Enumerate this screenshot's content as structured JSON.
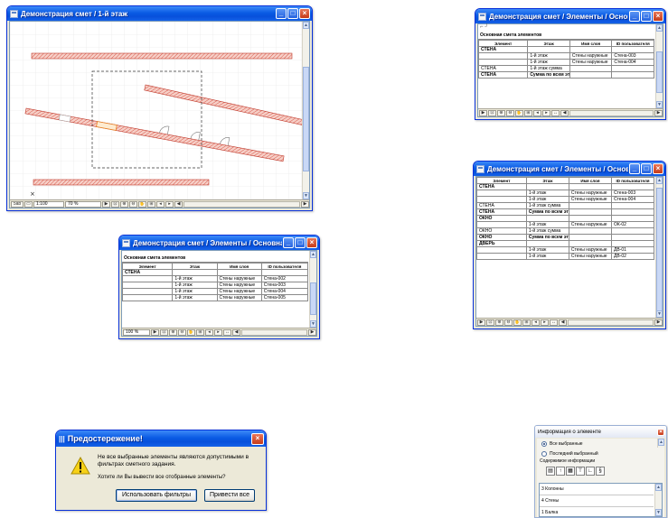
{
  "plan_window": {
    "title": "Демонстрация смет / 1-й этаж",
    "scale": "1:100",
    "zoom": "70 %",
    "toggle_icon": "5ab"
  },
  "table_window_top": {
    "title": "Демонстрация смет / Элементы / Основная...",
    "caption": "Основная смета элементов",
    "headers": [
      "Элемент",
      "Этаж",
      "Имя слоя",
      "ID пользователя"
    ],
    "rows": [
      {
        "cells": [
          "СТЕНА",
          "",
          "",
          ""
        ],
        "bold": true
      },
      {
        "cells": [
          "",
          "1-й этаж",
          "Стены наружные",
          "Стена-003"
        ],
        "bold": false
      },
      {
        "cells": [
          "",
          "1-й этаж",
          "Стены наружные",
          "Стена-004"
        ],
        "bold": false
      },
      {
        "cells": [
          "СТЕНА",
          "1-й этаж сумма",
          "",
          ""
        ],
        "bold": false
      },
      {
        "cells": [
          "СТЕНА",
          "Сумма по всем этажам",
          "",
          ""
        ],
        "bold": true
      }
    ]
  },
  "table_window_mid": {
    "title": "Демонстрация смет / Элементы / Основная см...",
    "caption": "Основная смета элементов",
    "zoom": "100 %",
    "headers": [
      "Элемент",
      "Этаж",
      "Имя слоя",
      "ID пользователя"
    ],
    "rows": [
      {
        "cells": [
          "СТЕНА",
          "",
          "",
          ""
        ],
        "bold": true
      },
      {
        "cells": [
          "",
          "1-й этаж",
          "Стены наружные",
          "Стена-002"
        ],
        "bold": false
      },
      {
        "cells": [
          "",
          "1-й этаж",
          "Стены наружные",
          "Стена-003"
        ],
        "bold": false
      },
      {
        "cells": [
          "",
          "1-й этаж",
          "Стены наружные",
          "Стена-004"
        ],
        "bold": false
      },
      {
        "cells": [
          "",
          "1-й этаж",
          "Стены наружные",
          "Стена-005"
        ],
        "bold": false
      }
    ]
  },
  "table_window_right": {
    "title": "Демонстрация смет / Элементы / Основная ...",
    "headers": [
      "Элемент",
      "Этаж",
      "Имя слоя",
      "ID пользователя"
    ],
    "rows": [
      {
        "cells": [
          "СТЕНА",
          "",
          "",
          ""
        ],
        "bold": true
      },
      {
        "cells": [
          "",
          "1-й этаж",
          "Стены наружные",
          "Стена-003"
        ],
        "bold": false
      },
      {
        "cells": [
          "",
          "1-й этаж",
          "Стены наружные",
          "Стена-004"
        ],
        "bold": false
      },
      {
        "cells": [
          "СТЕНА",
          "1-й этаж сумма",
          "",
          ""
        ],
        "bold": false
      },
      {
        "cells": [
          "СТЕНА",
          "Сумма по всем этажам",
          "",
          ""
        ],
        "bold": true
      },
      {
        "cells": [
          "ОКНО",
          "",
          "",
          ""
        ],
        "bold": true
      },
      {
        "cells": [
          "",
          "1-й этаж",
          "Стены наружные",
          "ОК-02"
        ],
        "bold": false
      },
      {
        "cells": [
          "ОКНО",
          "1-й этаж сумма",
          "",
          ""
        ],
        "bold": false
      },
      {
        "cells": [
          "ОКНО",
          "Сумма по всем этажам",
          "",
          ""
        ],
        "bold": true
      },
      {
        "cells": [
          "ДВЕРЬ",
          "",
          "",
          ""
        ],
        "bold": true
      },
      {
        "cells": [
          "",
          "1-й этаж",
          "Стены наружные",
          "ДВ-01"
        ],
        "bold": false
      },
      {
        "cells": [
          "",
          "1-й этаж",
          "Стены наружные",
          "ДВ-02"
        ],
        "bold": false
      }
    ]
  },
  "warning_dialog": {
    "title": "Предостережение!",
    "message": "Не все выбранные элементы являются допустимыми в фильтрах сметного задания.",
    "question": "Хотите ли Вы вывести все отобранные элементы?",
    "btn_filters": "Использовать фильтры",
    "btn_all": "Привести все"
  },
  "info_palette": {
    "title": "Информация о элементе",
    "radio_all": "Все выбранные",
    "radio_last": "Последний выбранный",
    "content_label": "Содержимое информации",
    "items": [
      "3 Колонны",
      "4 Стены",
      "1 Балка"
    ]
  }
}
